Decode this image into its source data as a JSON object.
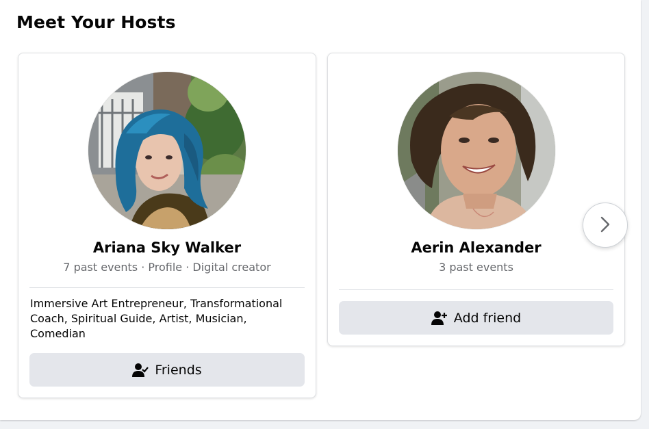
{
  "section": {
    "title": "Meet Your Hosts"
  },
  "hosts": [
    {
      "name": "Ariana Sky Walker",
      "meta": "7 past events · Profile · Digital creator",
      "bio": "Immersive Art Entrepreneur, Transformational Coach, Spiritual Guide, Artist, Musician, Comedian",
      "action_label": "Friends",
      "action_icon": "friends-check-icon"
    },
    {
      "name": "Aerin Alexander",
      "meta": "3 past events",
      "action_label": "Add friend",
      "action_icon": "add-friend-icon"
    }
  ],
  "carousel": {
    "next_icon": "chevron-right-icon"
  },
  "colors": {
    "background": "#f0f2f5",
    "card": "#ffffff",
    "button": "#e4e6eb",
    "secondary_text": "#65676b",
    "primary_text": "#050505"
  }
}
